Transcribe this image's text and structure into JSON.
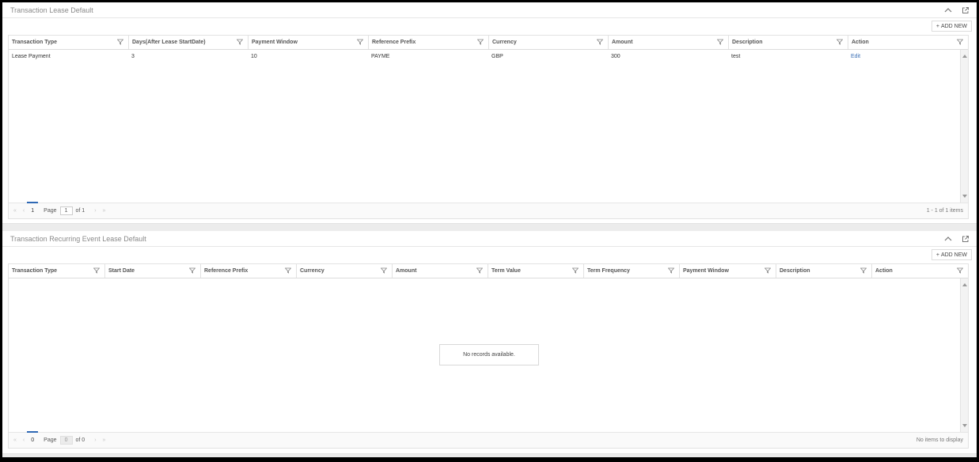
{
  "panel1": {
    "title": "Transaction Lease Default",
    "add_label": "ADD NEW",
    "columns": [
      "Transaction Type",
      "Days(After Lease StartDate)",
      "Payment Window",
      "Reference Prefix",
      "Currency",
      "Amount",
      "Description",
      "Action"
    ],
    "rows": [
      [
        "Lease Payment",
        "3",
        "10",
        "PAYME",
        "GBP",
        "300",
        "test",
        "Edit"
      ]
    ],
    "pager": {
      "current": "1",
      "page_label": "Page",
      "page_value": "1",
      "of_label": "of 1",
      "info": "1 - 1 of 1 items"
    }
  },
  "panel2": {
    "title": "Transaction Recurring Event Lease Default",
    "add_label": "ADD NEW",
    "columns": [
      "Transaction Type",
      "Start Date",
      "Reference Prefix",
      "Currency",
      "Amount",
      "Term Value",
      "Term Frequency",
      "Payment Window",
      "Description",
      "Action"
    ],
    "empty_message": "No records available.",
    "pager": {
      "current": "0",
      "page_label": "Page",
      "page_value": "0",
      "of_label": "of 0",
      "info": "No items to display"
    }
  },
  "icons": {
    "collapse": "chevron-up-icon",
    "popout": "external-link-icon",
    "filter": "filter-funnel-icon",
    "add": "plus-icon"
  },
  "colors": {
    "accent": "#2f69b4",
    "link": "#3a6fb5"
  }
}
